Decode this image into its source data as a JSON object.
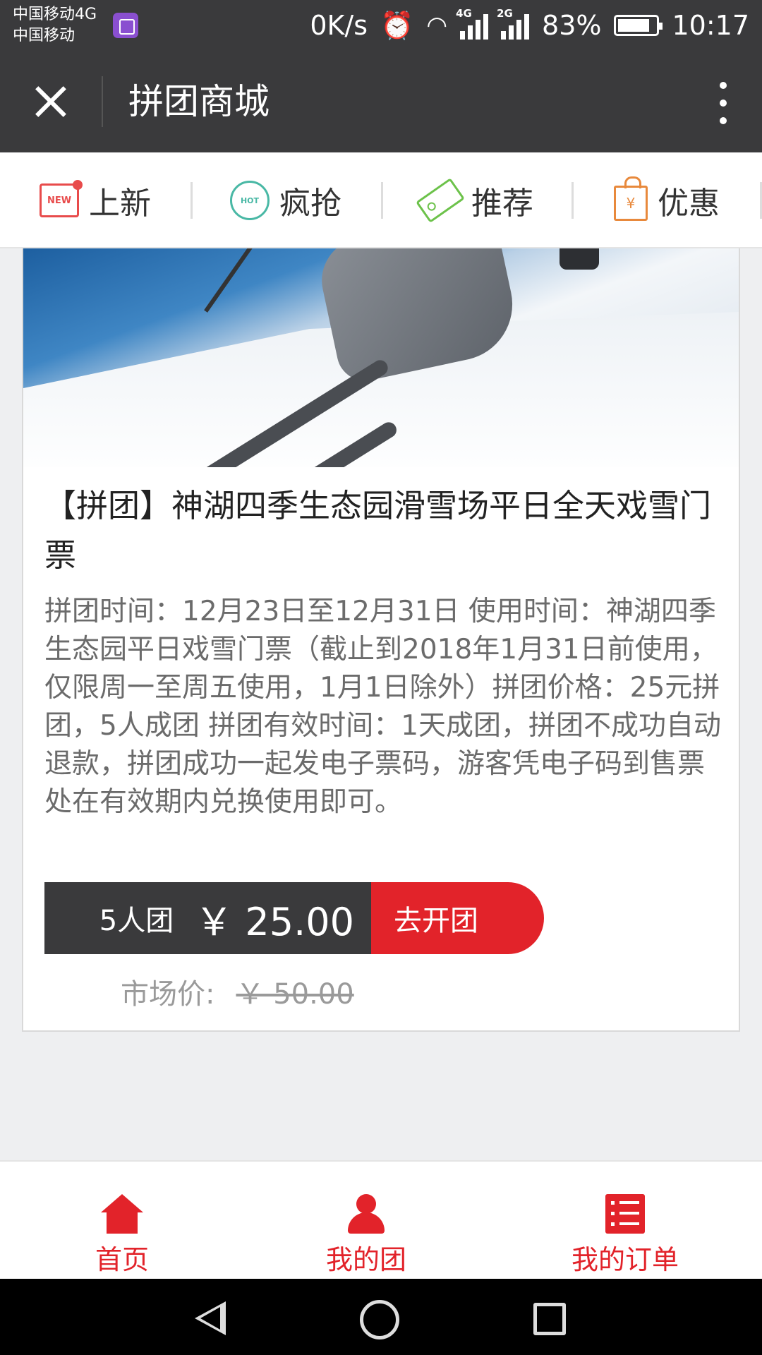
{
  "status_bar": {
    "carrier_line1": "中国移动4G",
    "carrier_line2": "中国移动",
    "net_speed": "0K/s",
    "sig1_label": "4G",
    "sig2_label": "2G",
    "battery_percent": "83%",
    "battery_level": 0.83,
    "time": "10:17"
  },
  "header": {
    "title": "拼团商城"
  },
  "categories": [
    {
      "label": "上新",
      "icon": "new-icon",
      "icon_text": "NEW",
      "color": "#e84b4b"
    },
    {
      "label": "疯抢",
      "icon": "hot-icon",
      "icon_text": "HOT",
      "color": "#49b8a5"
    },
    {
      "label": "推荐",
      "icon": "tag-icon",
      "color": "#6cc24a"
    },
    {
      "label": "优惠",
      "icon": "shopping-bag-icon",
      "icon_text": "¥",
      "color": "#e8893c"
    }
  ],
  "product": {
    "title": "【拼团】神湖四季生态园滑雪场平日全天戏雪门票",
    "description": "拼团时间：12月23日至12月31日 使用时间：神湖四季生态园平日戏雪门票（截止到2018年1月31日前使用，仅限周一至周五使用，1月1日除外）拼团价格：25元拼团，5人成团 拼团有效时间：1天成团，拼团不成功自动退款，拼团成功一起发电子票码，游客凭电子码到售票处在有效期内兑换使用即可。",
    "group_size": "5人团",
    "group_price": "￥ 25.00",
    "buy_button": "去开团",
    "market_label": "市场价:",
    "market_price": "￥ 50.00"
  },
  "tabs": [
    {
      "label": "首页",
      "icon": "home-icon"
    },
    {
      "label": "我的团",
      "icon": "user-icon"
    },
    {
      "label": "我的订单",
      "icon": "order-list-icon"
    }
  ],
  "colors": {
    "accent": "#e2232a",
    "header_bg": "#3a3a3c"
  }
}
